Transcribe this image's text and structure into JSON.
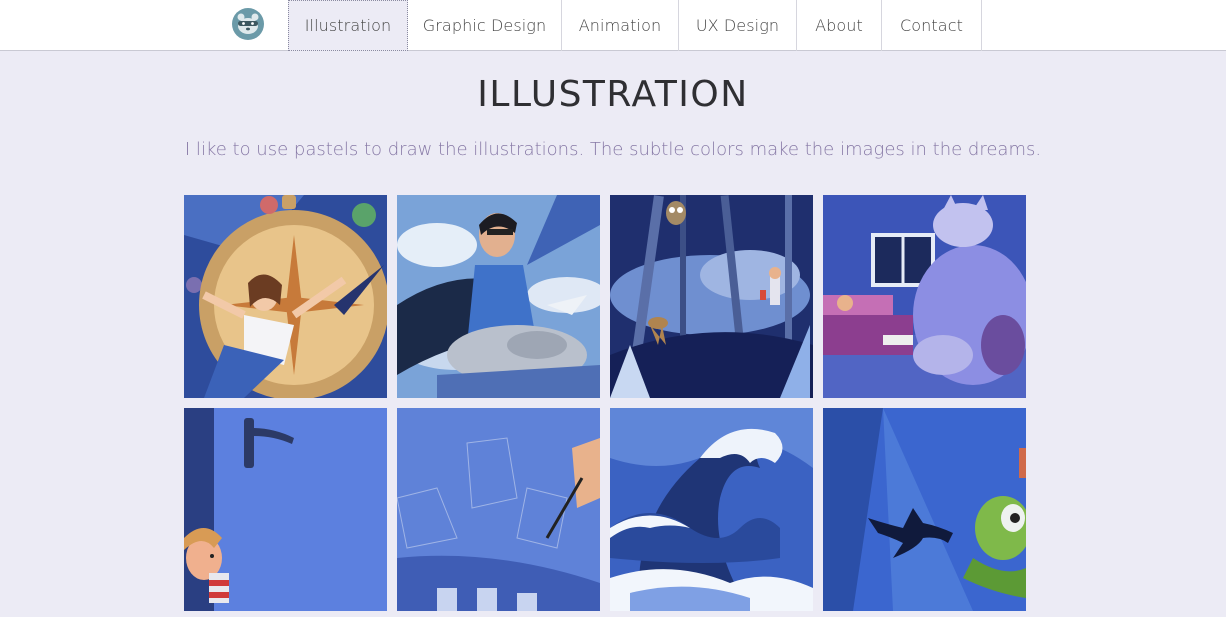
{
  "colors": {
    "page_bg": "#ecebf5",
    "accent": "#8779a6",
    "logo_bg": "#6b9aa8"
  },
  "nav": {
    "logo_icon": "raccoon-logo-icon",
    "items": [
      {
        "label": "Illustration",
        "active": true
      },
      {
        "label": "Graphic Design",
        "active": false
      },
      {
        "label": "Animation",
        "active": false
      },
      {
        "label": "UX Design",
        "active": false
      },
      {
        "label": "About",
        "active": false
      },
      {
        "label": "Contact",
        "active": false
      }
    ]
  },
  "page": {
    "title": "ILLUSTRATION",
    "subtitle": "I like to use pastels to draw the illustrations. The subtle colors make the images in the dreams."
  },
  "gallery": {
    "items": [
      {
        "name": "girl-compass-illustration"
      },
      {
        "name": "boy-flying-plane-illustration"
      },
      {
        "name": "forest-night-deer-illustration"
      },
      {
        "name": "bedroom-cat-illustration"
      },
      {
        "name": "boy-behind-door-illustration"
      },
      {
        "name": "hand-drawing-blueprint-illustration"
      },
      {
        "name": "great-wave-illustration"
      },
      {
        "name": "turtle-underwater-illustration"
      }
    ]
  }
}
